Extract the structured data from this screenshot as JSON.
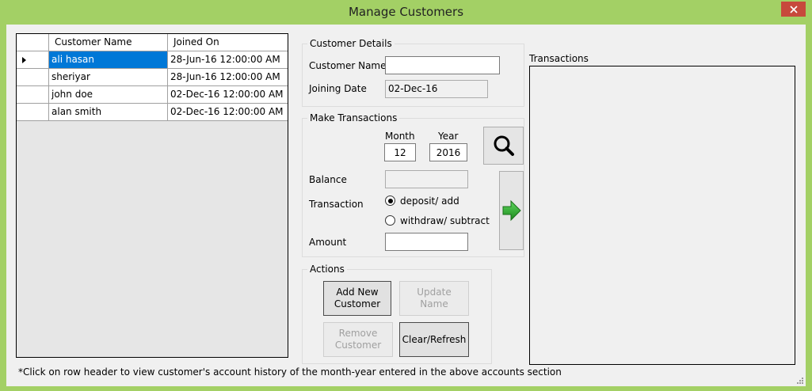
{
  "window": {
    "title": "Manage Customers",
    "close_icon": "close-icon"
  },
  "grid": {
    "columns": [
      "Customer Name",
      "Joined On"
    ],
    "rows": [
      {
        "name": "ali hasan",
        "joined": "28-Jun-16 12:00:00 AM",
        "selected": true
      },
      {
        "name": "sheriyar",
        "joined": "28-Jun-16 12:00:00 AM",
        "selected": false
      },
      {
        "name": "john doe",
        "joined": "02-Dec-16 12:00:00 AM",
        "selected": false
      },
      {
        "name": "alan smith",
        "joined": "02-Dec-16 12:00:00 AM",
        "selected": false
      }
    ]
  },
  "customer_details": {
    "legend": "Customer Details",
    "name_label": "Customer Name",
    "name_value": "",
    "date_label": "Joining Date",
    "date_value": "02-Dec-16"
  },
  "make_transactions": {
    "legend": "Make Transactions",
    "month_label": "Month",
    "month_value": "12",
    "year_label": "Year",
    "year_value": "2016",
    "search_icon": "search-icon",
    "balance_label": "Balance",
    "balance_value": "",
    "transaction_label": "Transaction",
    "options": [
      {
        "label": "deposit/ add",
        "checked": true
      },
      {
        "label": "withdraw/ subtract",
        "checked": false
      }
    ],
    "amount_label": "Amount",
    "amount_value": "",
    "submit_icon": "arrow-right-icon"
  },
  "actions": {
    "legend": "Actions",
    "add": [
      "Add New",
      "Customer"
    ],
    "update": [
      "Update",
      "Name"
    ],
    "remove": [
      "Remove",
      "Customer"
    ],
    "clear": "Clear/Refresh"
  },
  "transactions": {
    "label": "Transactions"
  },
  "footer": {
    "note": "*Click on row header to view customer's account history of the month-year entered in the above accounts section"
  },
  "colors": {
    "frame": "#a3d065",
    "selection": "#0078d7",
    "close": "#c7493c",
    "arrow": "#2e9e2e"
  }
}
